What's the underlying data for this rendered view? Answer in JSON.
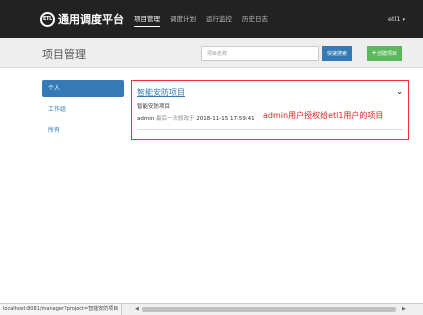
{
  "header": {
    "logo_mark": "ETL",
    "app_name": "通用调度平台",
    "nav": [
      {
        "label": "项目管理",
        "active": true
      },
      {
        "label": "调度计划",
        "active": false
      },
      {
        "label": "运行监控",
        "active": false
      },
      {
        "label": "历史日志",
        "active": false
      }
    ],
    "user": "etl1",
    "user_caret": "▾"
  },
  "subheader": {
    "title": "项目管理",
    "search_placeholder": "项目名称",
    "search_button": "快速搜索",
    "create_plus": "+",
    "create_button": "创建项目"
  },
  "sidebar": {
    "items": [
      {
        "label": "个人",
        "active": true
      },
      {
        "label": "工作组",
        "active": false
      },
      {
        "label": "所有",
        "active": false
      }
    ]
  },
  "project_card": {
    "title": "智能安防项目",
    "chevron": "⌄",
    "description": "智能安防项目",
    "owner": "admin",
    "modified_label": "最后一次修改于",
    "modified_time": "2018-11-15 17:59:41"
  },
  "annotation": "admin用户授权给etl1用户的项目",
  "statusbar": {
    "url": "localhost:8081/manager?project=智能安防项目",
    "scroll_left": "◀",
    "scroll_right": "▶"
  },
  "colors": {
    "topbar": "#222222",
    "primary": "#337ab7",
    "success": "#5cb85c",
    "annotation": "#e02020"
  },
  "icons": [
    "etl-logo-icon",
    "chevron-down-icon",
    "plus-icon"
  ]
}
